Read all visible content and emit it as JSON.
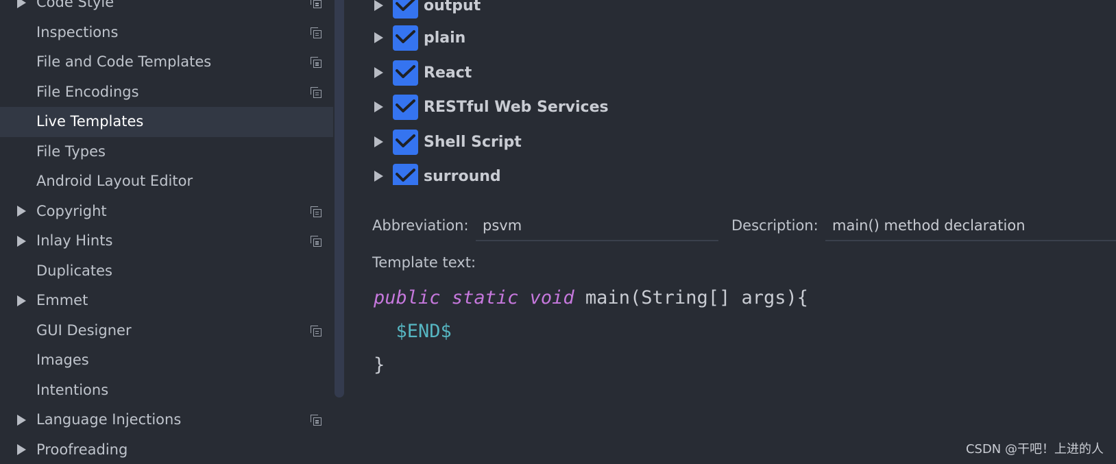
{
  "sidebar": {
    "items": [
      {
        "label": "Code Style",
        "arrow": true,
        "copy": true,
        "selected": false
      },
      {
        "label": "Inspections",
        "arrow": false,
        "copy": true,
        "selected": false
      },
      {
        "label": "File and Code Templates",
        "arrow": false,
        "copy": true,
        "selected": false
      },
      {
        "label": "File Encodings",
        "arrow": false,
        "copy": true,
        "selected": false
      },
      {
        "label": "Live Templates",
        "arrow": false,
        "copy": false,
        "selected": true
      },
      {
        "label": "File Types",
        "arrow": false,
        "copy": false,
        "selected": false
      },
      {
        "label": "Android Layout Editor",
        "arrow": false,
        "copy": false,
        "selected": false
      },
      {
        "label": "Copyright",
        "arrow": true,
        "copy": true,
        "selected": false
      },
      {
        "label": "Inlay Hints",
        "arrow": true,
        "copy": true,
        "selected": false
      },
      {
        "label": "Duplicates",
        "arrow": false,
        "copy": false,
        "selected": false
      },
      {
        "label": "Emmet",
        "arrow": true,
        "copy": false,
        "selected": false
      },
      {
        "label": "GUI Designer",
        "arrow": false,
        "copy": true,
        "selected": false
      },
      {
        "label": "Images",
        "arrow": false,
        "copy": false,
        "selected": false
      },
      {
        "label": "Intentions",
        "arrow": false,
        "copy": false,
        "selected": false
      },
      {
        "label": "Language Injections",
        "arrow": true,
        "copy": true,
        "selected": false
      },
      {
        "label": "Proofreading",
        "arrow": true,
        "copy": false,
        "selected": false
      }
    ]
  },
  "template_groups": [
    {
      "label": "output",
      "checked": true
    },
    {
      "label": "plain",
      "checked": true
    },
    {
      "label": "React",
      "checked": true
    },
    {
      "label": "RESTful Web Services",
      "checked": true
    },
    {
      "label": "Shell Script",
      "checked": true
    },
    {
      "label": "surround",
      "checked": true
    }
  ],
  "form": {
    "abbreviation_label": "Abbreviation:",
    "abbreviation_value": "psvm",
    "description_label": "Description:",
    "description_value": "main() method declaration",
    "template_text_label": "Template text:"
  },
  "template_code": {
    "line1_kw1": "public",
    "line1_kw2": "static",
    "line1_kw3": "void",
    "line1_rest": "main(String[] args){",
    "line2_var": "$END$",
    "line3": "}"
  },
  "watermark": "CSDN @干吧！上进的人",
  "colors": {
    "background": "#282c34",
    "selected_row": "#323844",
    "checkbox": "#3574f0",
    "keyword": "#c678dd",
    "variable": "#56b6c2"
  }
}
